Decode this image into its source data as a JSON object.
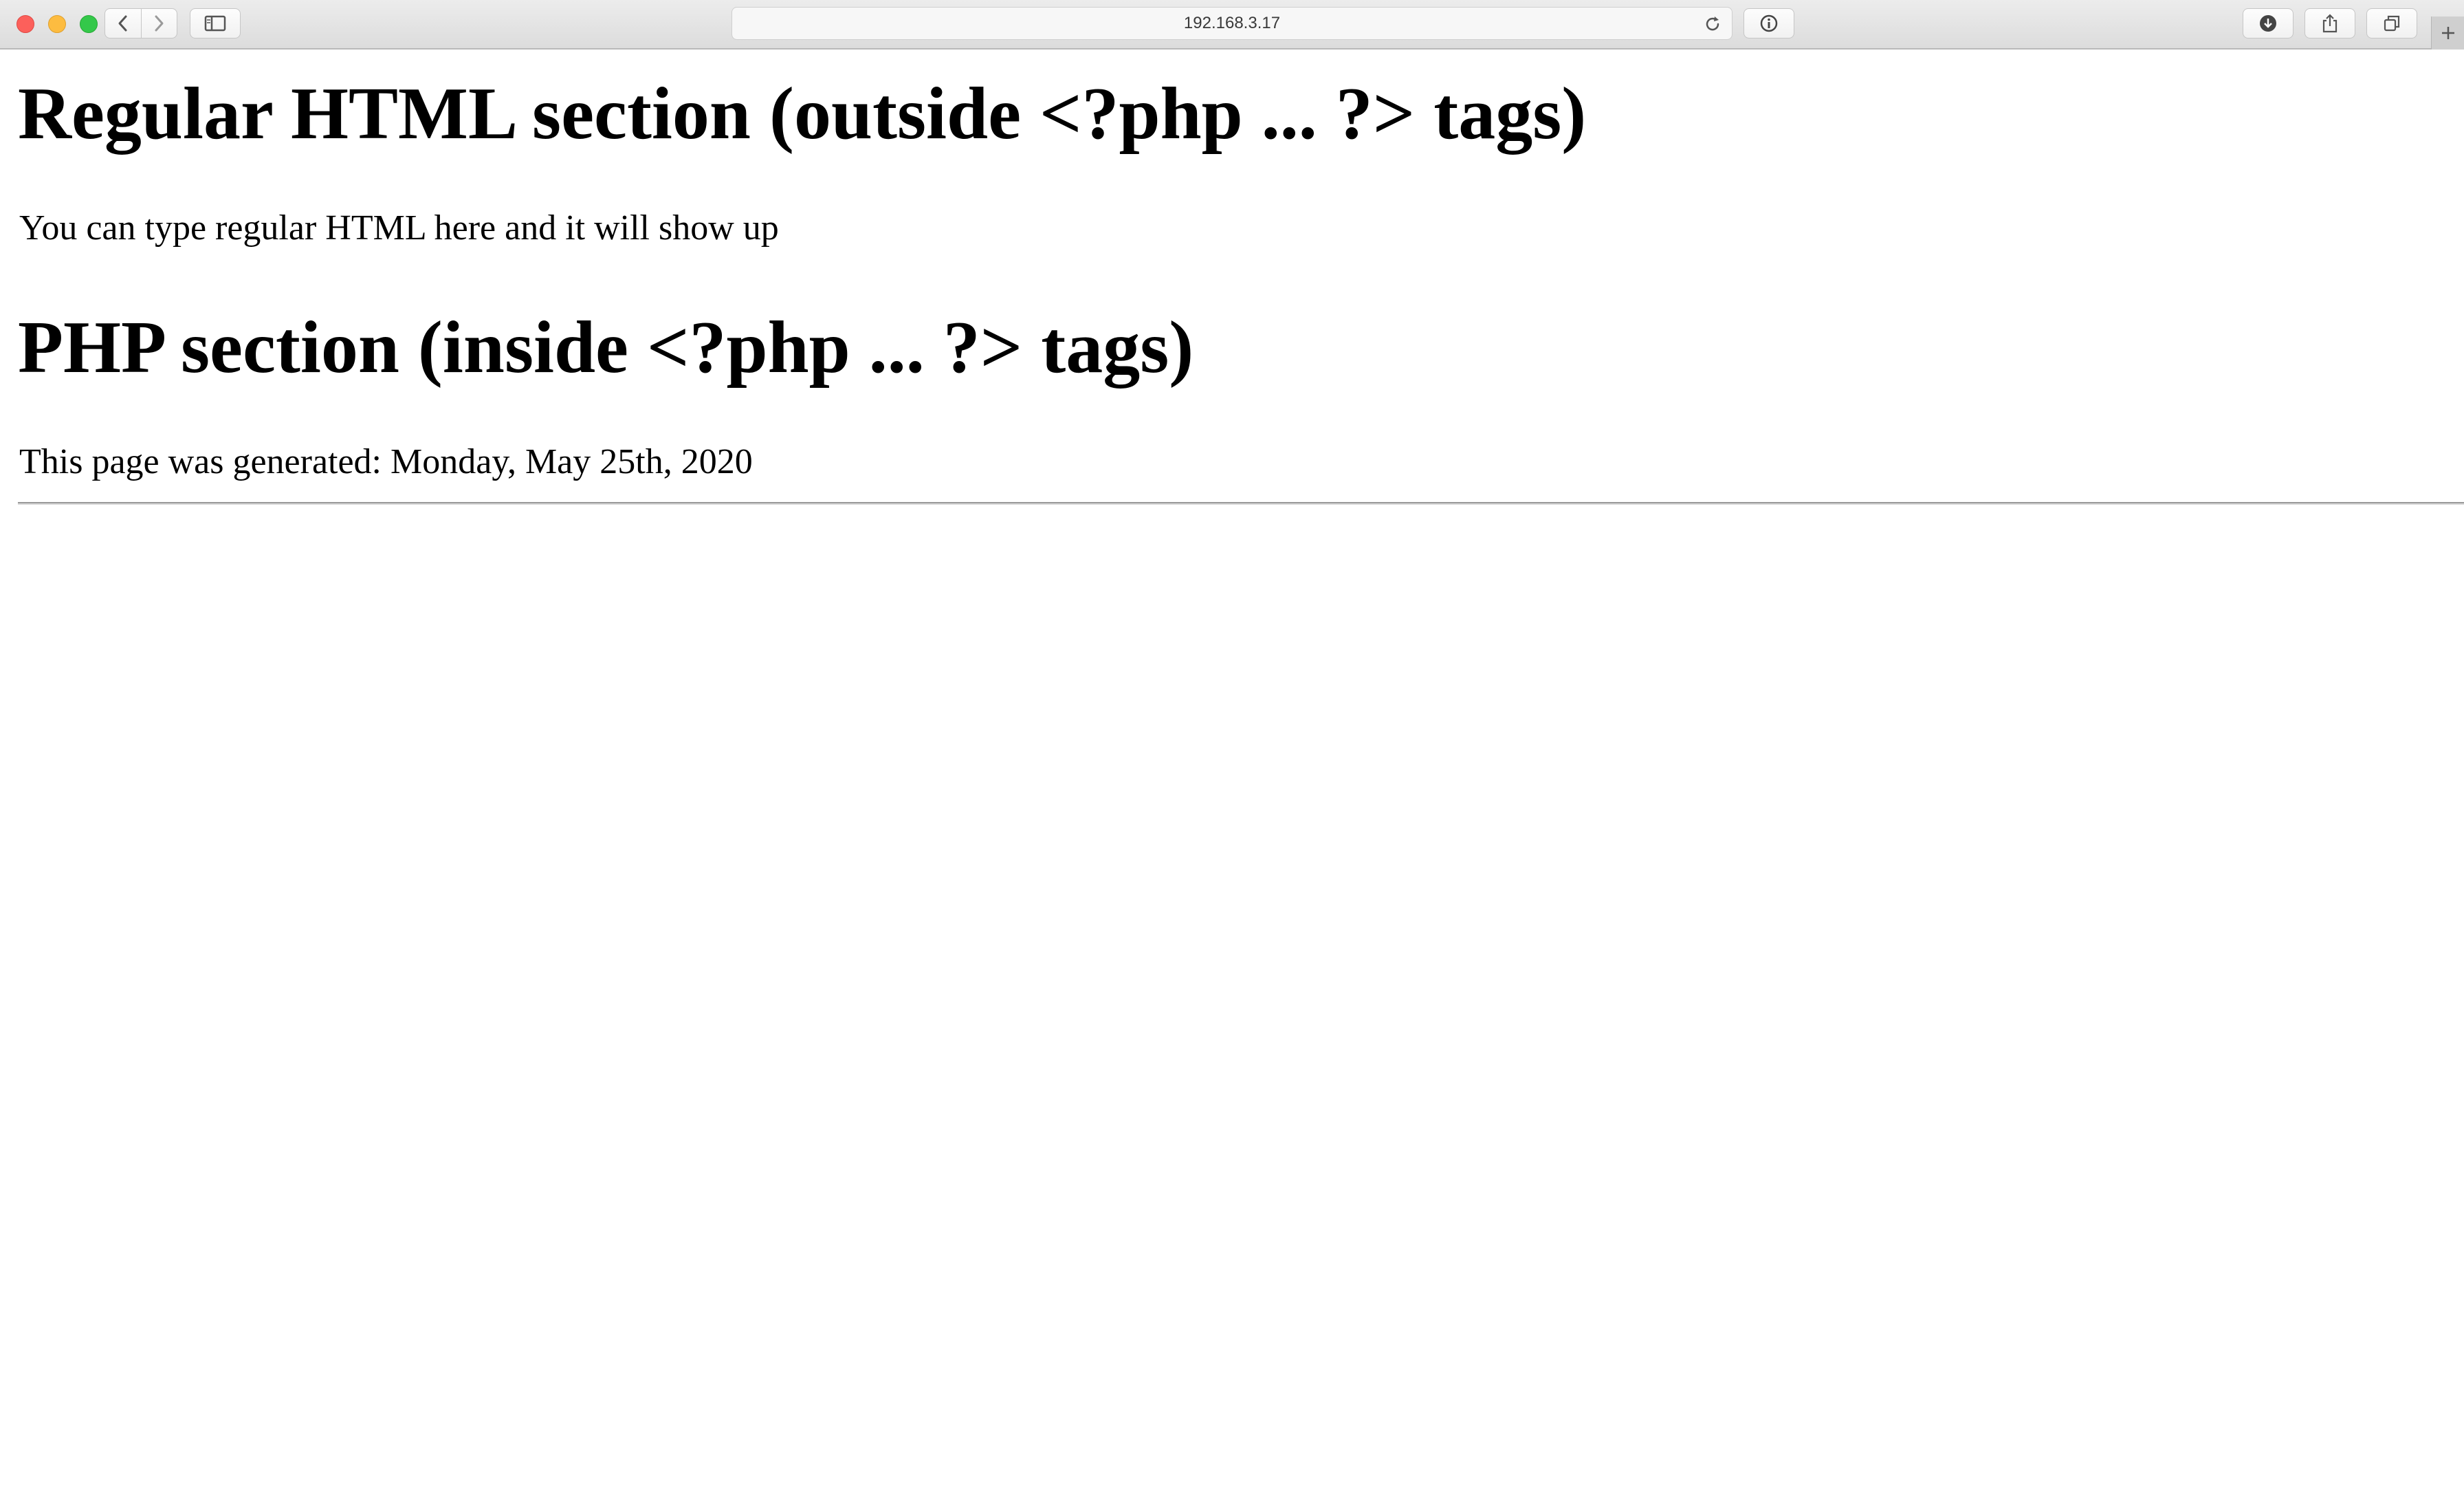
{
  "browser": {
    "url": "192.168.3.17",
    "icons": {
      "back": "chevron-left-icon",
      "forward": "chevron-right-icon",
      "sidebar": "sidebar-icon",
      "reload": "reload-icon",
      "info": "info-icon",
      "downloads": "download-icon",
      "share": "share-icon",
      "tabs": "tabs-icon",
      "new_tab": "plus-icon"
    }
  },
  "page": {
    "heading_html": "Regular HTML section (outside <?php ... ?> tags)",
    "paragraph_html": "You can type regular HTML here and it will show up",
    "heading_php": "PHP section (inside <?php ... ?> tags)",
    "paragraph_php": "This page was generated: Monday, May 25th, 2020"
  }
}
